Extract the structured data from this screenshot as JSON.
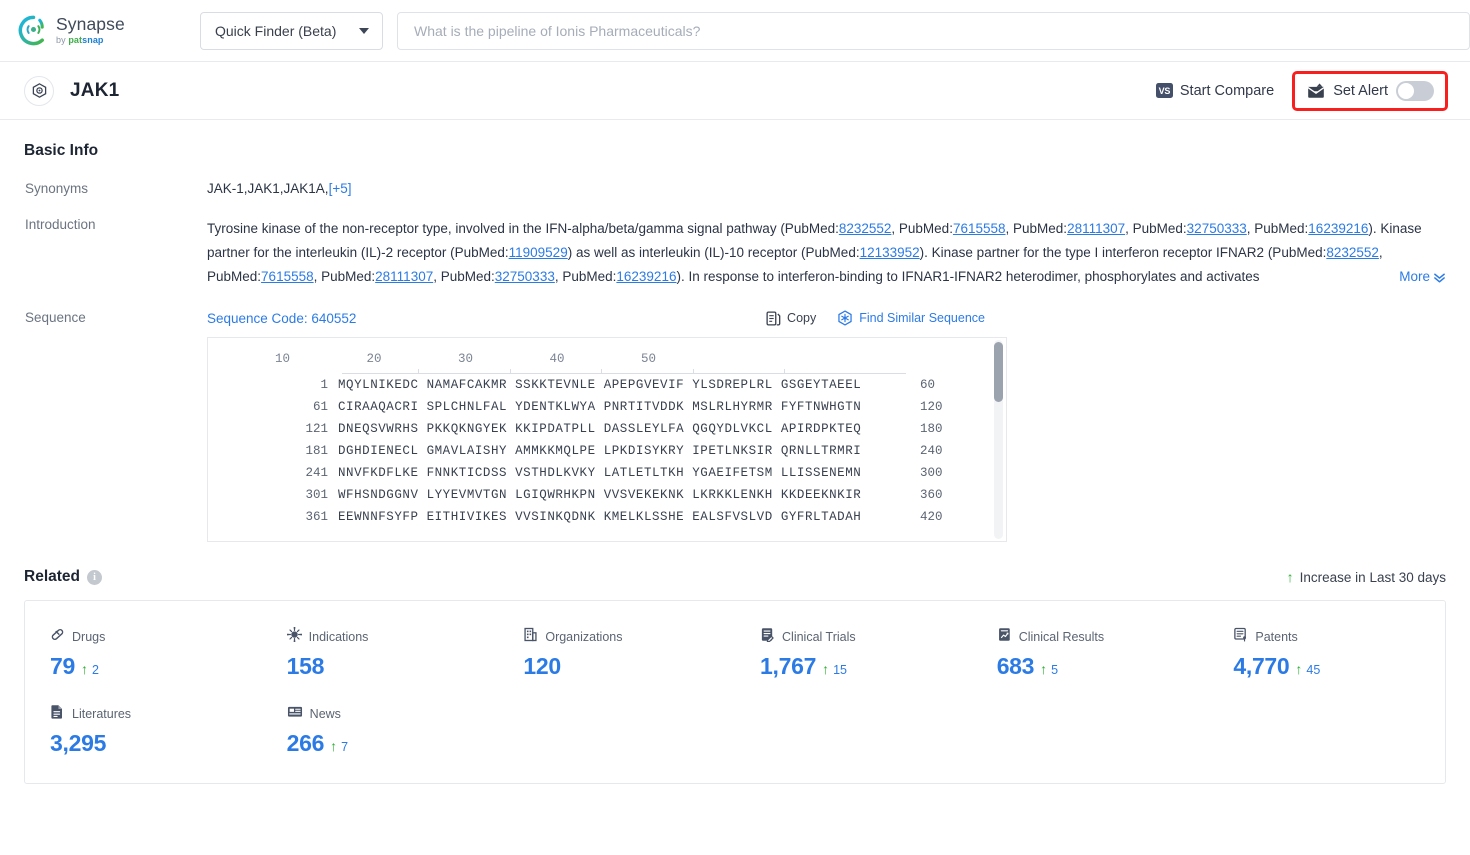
{
  "header": {
    "logo_name": "Synapse",
    "logo_sub_prefix": "by ",
    "logo_sub_pat": "pat",
    "logo_sub_snap": "snap",
    "finder_label": "Quick Finder (Beta)",
    "search_placeholder": "What is the pipeline of Ionis Pharmaceuticals?",
    "search_value": ""
  },
  "entity": {
    "title": "JAK1",
    "start_compare_label": "Start Compare",
    "vs_badge": "VS",
    "set_alert_label": "Set Alert",
    "alert_enabled": false
  },
  "basic_info": {
    "title": "Basic Info",
    "synonyms_label": "Synonyms",
    "synonyms_value": "JAK-1,JAK1,JAK1A,",
    "synonyms_more": "[+5]",
    "introduction_label": "Introduction",
    "introduction_more": "More",
    "introduction_parts": [
      {
        "t": "text",
        "v": "Tyrosine kinase of the non-receptor type, involved in the IFN-alpha/beta/gamma signal pathway (PubMed:"
      },
      {
        "t": "link",
        "v": "8232552"
      },
      {
        "t": "text",
        "v": ", PubMed:"
      },
      {
        "t": "link",
        "v": "7615558"
      },
      {
        "t": "text",
        "v": ", PubMed:"
      },
      {
        "t": "link",
        "v": "28111307"
      },
      {
        "t": "text",
        "v": ", PubMed:"
      },
      {
        "t": "link",
        "v": "32750333"
      },
      {
        "t": "text",
        "v": ", PubMed:"
      },
      {
        "t": "link",
        "v": "16239216"
      },
      {
        "t": "text",
        "v": "). Kinase partner for the interleukin (IL)-2 receptor (PubMed:"
      },
      {
        "t": "link",
        "v": "11909529"
      },
      {
        "t": "text",
        "v": ") as well as interleukin (IL)-10 receptor (PubMed:"
      },
      {
        "t": "link",
        "v": "12133952"
      },
      {
        "t": "text",
        "v": "). Kinase partner for the type I interferon receptor IFNAR2 (PubMed:"
      },
      {
        "t": "link",
        "v": "8232552"
      },
      {
        "t": "text",
        "v": ", PubMed:"
      },
      {
        "t": "link",
        "v": "7615558"
      },
      {
        "t": "text",
        "v": ", PubMed:"
      },
      {
        "t": "link",
        "v": "28111307"
      },
      {
        "t": "text",
        "v": ", PubMed:"
      },
      {
        "t": "link",
        "v": "32750333"
      },
      {
        "t": "text",
        "v": ", PubMed:"
      },
      {
        "t": "link",
        "v": "16239216"
      },
      {
        "t": "text",
        "v": "). In response to interferon-binding to IFNAR1-IFNAR2 heterodimer, phosphorylates and activates"
      }
    ]
  },
  "sequence": {
    "row_label": "Sequence",
    "code_label": "Sequence Code: 640552",
    "copy_label": "Copy",
    "find_similar_label": "Find Similar Sequence",
    "ruler_ticks": [
      "10",
      "20",
      "30",
      "40",
      "50"
    ],
    "rows": [
      {
        "start": "1",
        "chunks": "MQYLNIKEDC NAMAFCAKMR SSKKTEVNLE APEPGVEVIF YLSDREPLRL GSGEYTAEEL",
        "end": "60"
      },
      {
        "start": "61",
        "chunks": "CIRAAQACRI SPLCHNLFAL YDENTKLWYA PNRTITVDDK MSLRLHYRMR FYFTNWHGTN",
        "end": "120"
      },
      {
        "start": "121",
        "chunks": "DNEQSVWRHS PKKQKNGYEK KKIPDATPLL DASSLEYLFA QGQYDLVKCL APIRDPKTEQ",
        "end": "180"
      },
      {
        "start": "181",
        "chunks": "DGHDIENECL GMAVLAISHY AMMKKMQLPE LPKDISYKRY IPETLNKSIR QRNLLTRMRI",
        "end": "240"
      },
      {
        "start": "241",
        "chunks": "NNVFKDFLKE FNNKTICDSS VSTHDLKVKY LATLETLTKH YGAEIFETSM LLISSENEMN",
        "end": "300"
      },
      {
        "start": "301",
        "chunks": "WFHSNDGGNV LYYEVMVTGN LGIQWRHKPN VVSVEKEKNK LKRKKLENKH KKDEEKNKIR",
        "end": "360"
      },
      {
        "start": "361",
        "chunks": "EEWNNFSYFP EITHIVIKES VVSINKQDNK KMELKLSSHE EALSFVSLVD GYFRLTADAH",
        "end": "420"
      }
    ]
  },
  "related": {
    "title": "Related",
    "legend": "Increase in Last 30 days",
    "row1": [
      {
        "icon": "pill-icon",
        "name": "Drugs",
        "value": "79",
        "delta": "2"
      },
      {
        "icon": "virus-icon",
        "name": "Indications",
        "value": "158",
        "delta": ""
      },
      {
        "icon": "building-icon",
        "name": "Organizations",
        "value": "120",
        "delta": ""
      },
      {
        "icon": "clinical-trials-icon",
        "name": "Clinical Trials",
        "value": "1,767",
        "delta": "15"
      },
      {
        "icon": "clinical-results-icon",
        "name": "Clinical Results",
        "value": "683",
        "delta": "5"
      },
      {
        "icon": "patents-icon",
        "name": "Patents",
        "value": "4,770",
        "delta": "45"
      }
    ],
    "row2": [
      {
        "icon": "literature-icon",
        "name": "Literatures",
        "value": "3,295",
        "delta": ""
      },
      {
        "icon": "news-icon",
        "name": "News",
        "value": "266",
        "delta": "7"
      }
    ]
  }
}
